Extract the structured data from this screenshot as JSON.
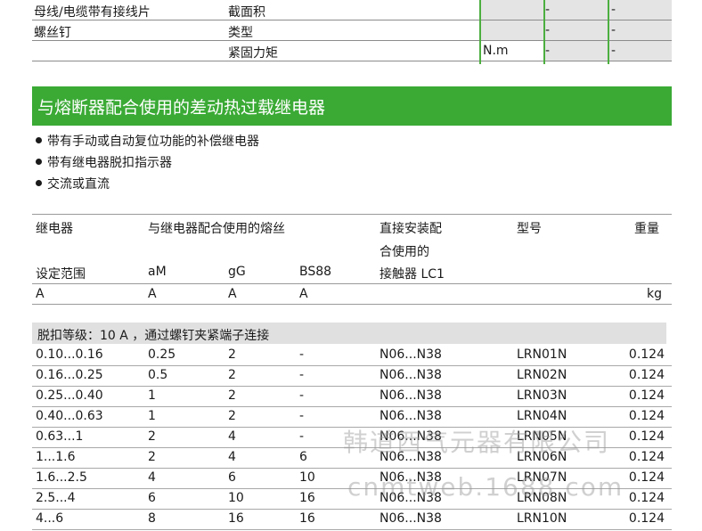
{
  "top_table": {
    "rows": [
      {
        "c1": "母线/电缆带有接线片",
        "c2": "截面积",
        "unit": "",
        "v1": "-",
        "v2": "-"
      },
      {
        "c1": "螺丝钉",
        "c2": "类型",
        "unit": "",
        "v1": "-",
        "v2": "-"
      },
      {
        "c1": "",
        "c2": "紧固力矩",
        "unit": "N.m",
        "v1": "-",
        "v2": "-"
      }
    ]
  },
  "section": {
    "title": "与熔断器配合使用的差动热过载继电器",
    "bullets": [
      "带有手动或自动复位功能的补偿继电器",
      "带有继电器脱扣指示器",
      "交流或直流"
    ]
  },
  "table": {
    "header": {
      "relay": "继电器",
      "fuse": "与继电器配合使用的熔丝",
      "contactor_1": "直接安装配",
      "contactor_2": "合使用的",
      "contactor_3": "接触器 LC1",
      "model": "型号",
      "weight": "重量",
      "setting": "设定范围",
      "am": "aM",
      "gg": "gG",
      "bs88": "BS88",
      "unit_setting": "A",
      "unit_am": "A",
      "unit_gg": "A",
      "unit_bs88": "A",
      "unit_weight": "kg"
    },
    "group_label": "脱扣等级：10 A ，通过螺钉夹紧端子连接",
    "rows": [
      {
        "range": "0.10...0.16",
        "am": "0.25",
        "gg": "2",
        "bs88": "-",
        "contactor": "N06...N38",
        "model": "LRN01N",
        "weight": "0.124"
      },
      {
        "range": "0.16...0.25",
        "am": "0.5",
        "gg": "2",
        "bs88": "-",
        "contactor": "N06...N38",
        "model": "LRN02N",
        "weight": "0.124"
      },
      {
        "range": "0.25...0.40",
        "am": "1",
        "gg": "2",
        "bs88": "-",
        "contactor": "N06...N38",
        "model": "LRN03N",
        "weight": "0.124"
      },
      {
        "range": "0.40...0.63",
        "am": "1",
        "gg": "2",
        "bs88": "-",
        "contactor": "N06...N38",
        "model": "LRN04N",
        "weight": "0.124"
      },
      {
        "range": "0.63...1",
        "am": "2",
        "gg": "4",
        "bs88": "-",
        "contactor": "N06...N38",
        "model": "LRN05N",
        "weight": "0.124"
      },
      {
        "range": "1...1.6",
        "am": "2",
        "gg": "4",
        "bs88": "6",
        "contactor": "N06...N38",
        "model": "LRN06N",
        "weight": "0.124"
      },
      {
        "range": "1.6...2.5",
        "am": "4",
        "gg": "6",
        "bs88": "10",
        "contactor": "N06...N38",
        "model": "LRN07N",
        "weight": "0.124"
      },
      {
        "range": "2.5...4",
        "am": "6",
        "gg": "10",
        "bs88": "16",
        "contactor": "N06...N38",
        "model": "LRN08N",
        "weight": "0.124"
      },
      {
        "range": "4...6",
        "am": "8",
        "gg": "16",
        "bs88": "16",
        "contactor": "N06...N38",
        "model": "LRN10N",
        "weight": "0.124"
      }
    ]
  },
  "watermark": {
    "line1": "韩道西气元器有限公司",
    "line2": "cnmtweb.1688.com"
  },
  "colors": {
    "green": "#3aaa35",
    "shade": "#e4e4e4"
  }
}
